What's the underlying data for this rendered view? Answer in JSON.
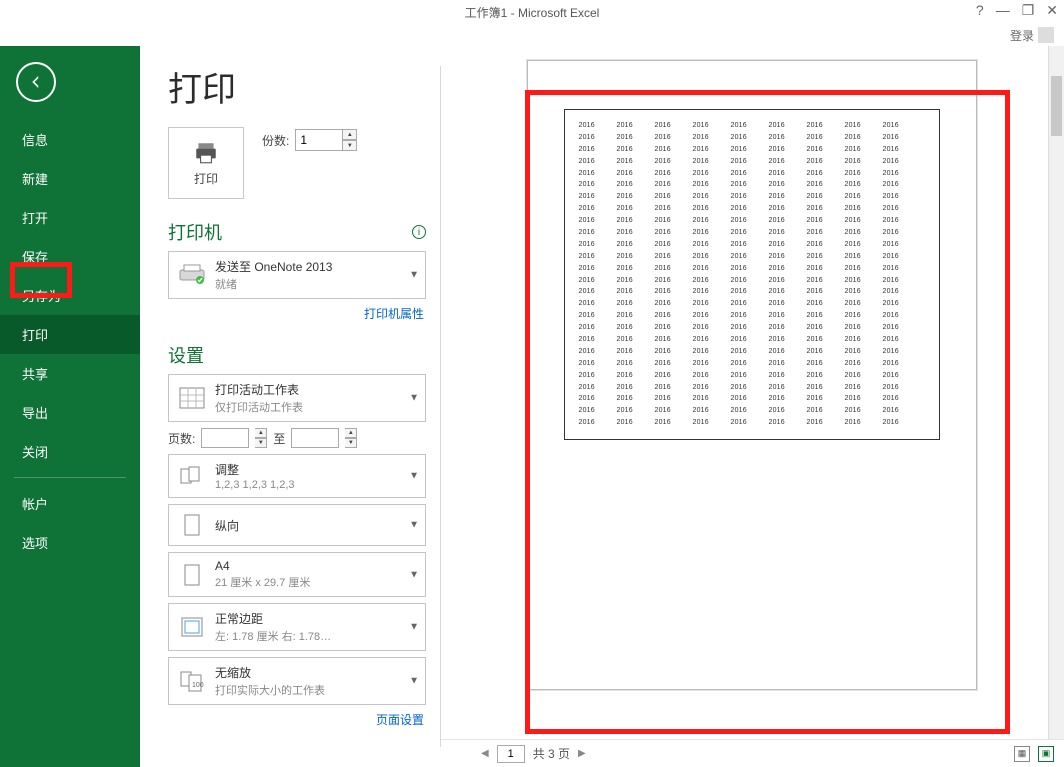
{
  "window": {
    "title": "工作簿1 - Microsoft Excel",
    "help": "?",
    "min": "—",
    "restore": "❐",
    "close": "✕",
    "login": "登录"
  },
  "sidebar": {
    "items": [
      "信息",
      "新建",
      "打开",
      "保存",
      "另存为",
      "打印",
      "共享",
      "导出",
      "关闭"
    ],
    "items2": [
      "帐户",
      "选项"
    ],
    "selected_index": 5
  },
  "print": {
    "heading": "打印",
    "button": "打印",
    "copies_label": "份数:",
    "copies_value": "1"
  },
  "printer_section": {
    "title": "打印机",
    "name": "发送至 OneNote 2013",
    "status": "就绪",
    "props_link": "打印机属性"
  },
  "settings_section": {
    "title": "设置",
    "active_sheet": {
      "title": "打印活动工作表",
      "sub": "仅打印活动工作表"
    },
    "pages_label": "页数:",
    "pages_to": "至",
    "collation": {
      "title": "调整",
      "sub": "1,2,3    1,2,3    1,2,3"
    },
    "orientation": {
      "title": "纵向"
    },
    "paper": {
      "title": "A4",
      "sub": "21 厘米 x 29.7 厘米"
    },
    "margins": {
      "title": "正常边距",
      "sub": "左: 1.78 厘米   右: 1.78…"
    },
    "scaling": {
      "title": "无缩放",
      "sub": "打印实际大小的工作表"
    },
    "setup_link": "页面设置"
  },
  "preview": {
    "cell_value": "2016",
    "rows": 26,
    "cols": 9,
    "page_current": "1",
    "page_total": "共 3 页"
  }
}
